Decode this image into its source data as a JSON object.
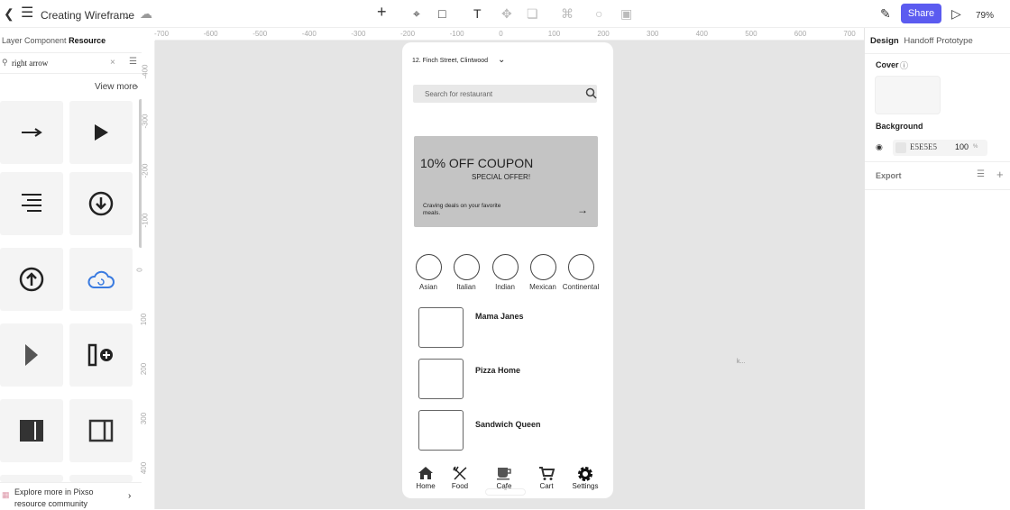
{
  "topbar": {
    "title": "Creating Wireframe",
    "share": "Share",
    "zoom": "79%"
  },
  "left": {
    "tabs": [
      "Layer",
      "Component",
      "Resource"
    ],
    "search_value": "right arrow",
    "view_more": "View more",
    "footer": "Explore more in Pixso resource community",
    "tiles": [
      "right-arrow-icon",
      "play-triangle-icon",
      "align-right-lines-icon",
      "download-circle-icon",
      "upload-circle-icon",
      "cloud-refresh-icon",
      "caret-right-icon",
      "column-add-icon",
      "panel-left-filled-icon",
      "panel-right-icon"
    ]
  },
  "rulers": {
    "h": [
      "-700",
      "-600",
      "-500",
      "-400",
      "-300",
      "-200",
      "-100",
      "0",
      "100",
      "200",
      "300",
      "400",
      "500",
      "600",
      "700"
    ],
    "v": [
      "-400",
      "-300",
      "-200",
      "-100",
      "0",
      "100",
      "200",
      "300",
      "400"
    ]
  },
  "phone": {
    "address": "12. Finch Street, Clintwood",
    "search_placeholder": "Search for restaurant",
    "coupon": {
      "title": "10% OFF COUPON",
      "subtitle": "SPECIAL OFFER!",
      "desc": "Craving deals on your favorite meals."
    },
    "categories": [
      "Asian",
      "Italian",
      "Indian",
      "Mexican",
      "Continental"
    ],
    "restaurants": [
      "Mama Janes",
      "Pizza Home",
      "Sandwich Queen"
    ],
    "nav": [
      "Home",
      "Food",
      "Cafe",
      "Cart",
      "Settings"
    ]
  },
  "canvas_label": "k...",
  "right": {
    "tabs": [
      "Design",
      "Handoff",
      "Prototype"
    ],
    "cover": "Cover",
    "background": "Background",
    "bg_hex": "E5E5E5",
    "bg_opacity": "100",
    "percent": "%",
    "export": "Export",
    "accent": "#5b5bf0"
  }
}
